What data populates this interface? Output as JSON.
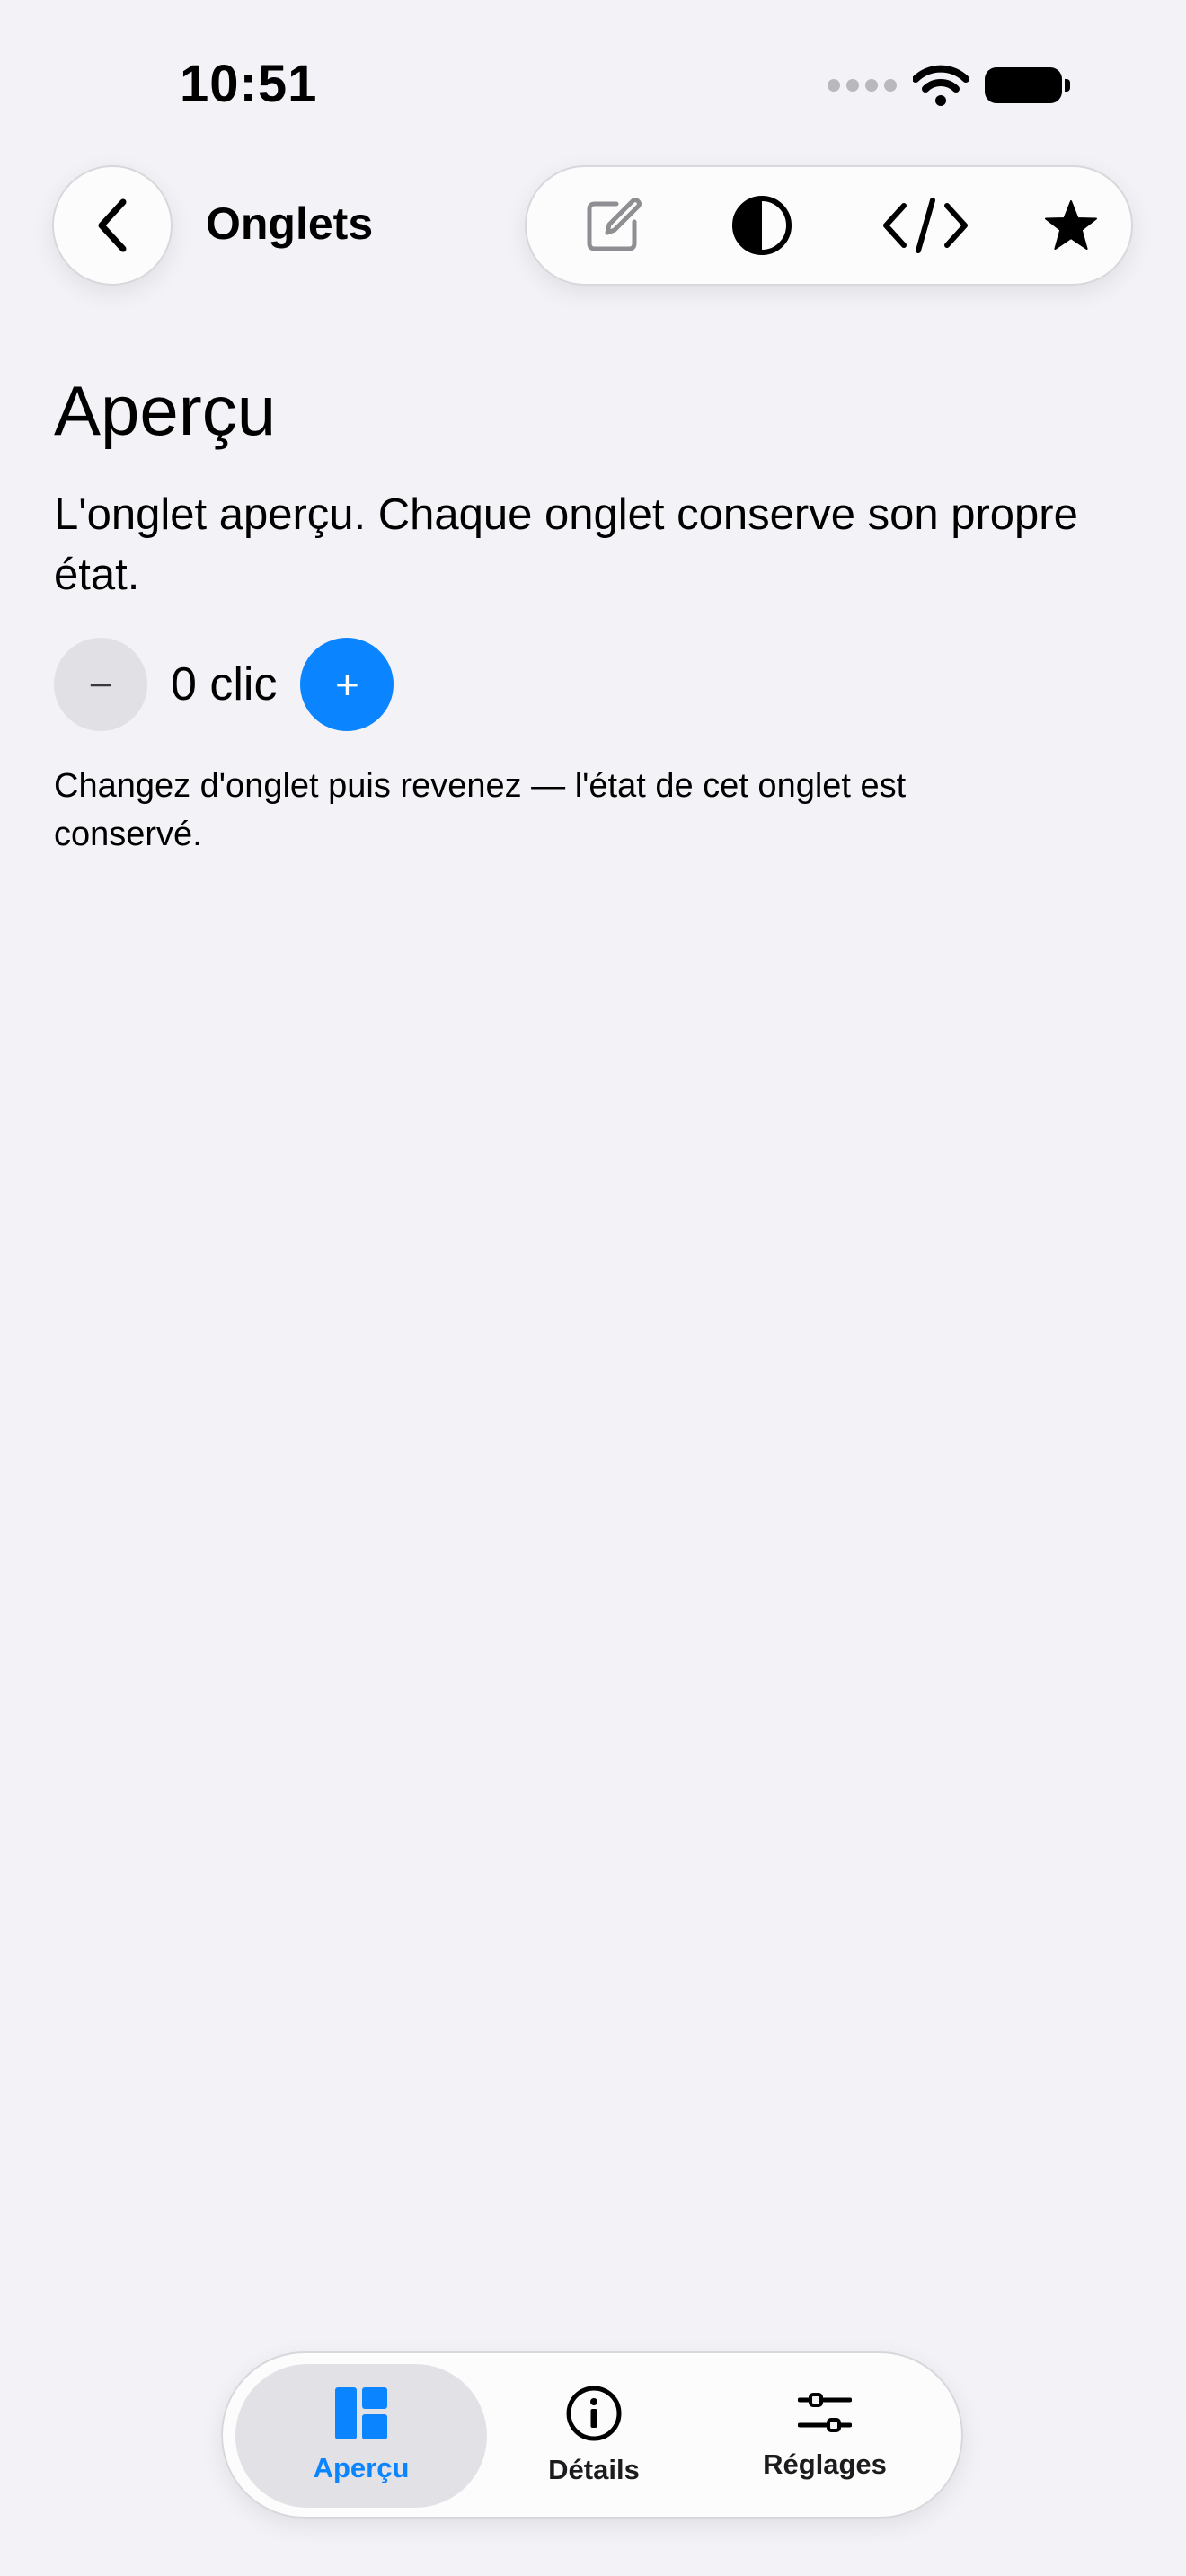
{
  "status_bar": {
    "time": "10:51",
    "icons": [
      "signal-dots-icon",
      "wifi-icon",
      "battery-icon"
    ]
  },
  "nav": {
    "back_icon": "chevron-left-icon",
    "title": "Onglets",
    "toolbar_icons": [
      "edit-icon",
      "contrast-icon",
      "code-icon",
      "star-icon"
    ]
  },
  "content": {
    "title": "Aperçu",
    "description": "L'onglet aperçu. Chaque onglet conserve son propre état.",
    "counter": {
      "minus_label": "−",
      "count_label": "0 clic",
      "plus_label": "+"
    },
    "hint": "Changez d'onglet puis revenez — l'état de cet onglet est conservé."
  },
  "tabbar": {
    "tabs": [
      {
        "label": "Aperçu",
        "icon": "dashboard-icon",
        "active": true
      },
      {
        "label": "Détails",
        "icon": "info-icon",
        "active": false
      },
      {
        "label": "Réglages",
        "icon": "sliders-icon",
        "active": false
      }
    ]
  },
  "colors": {
    "background": "#f2f2f7",
    "accent": "#0a84ff"
  }
}
